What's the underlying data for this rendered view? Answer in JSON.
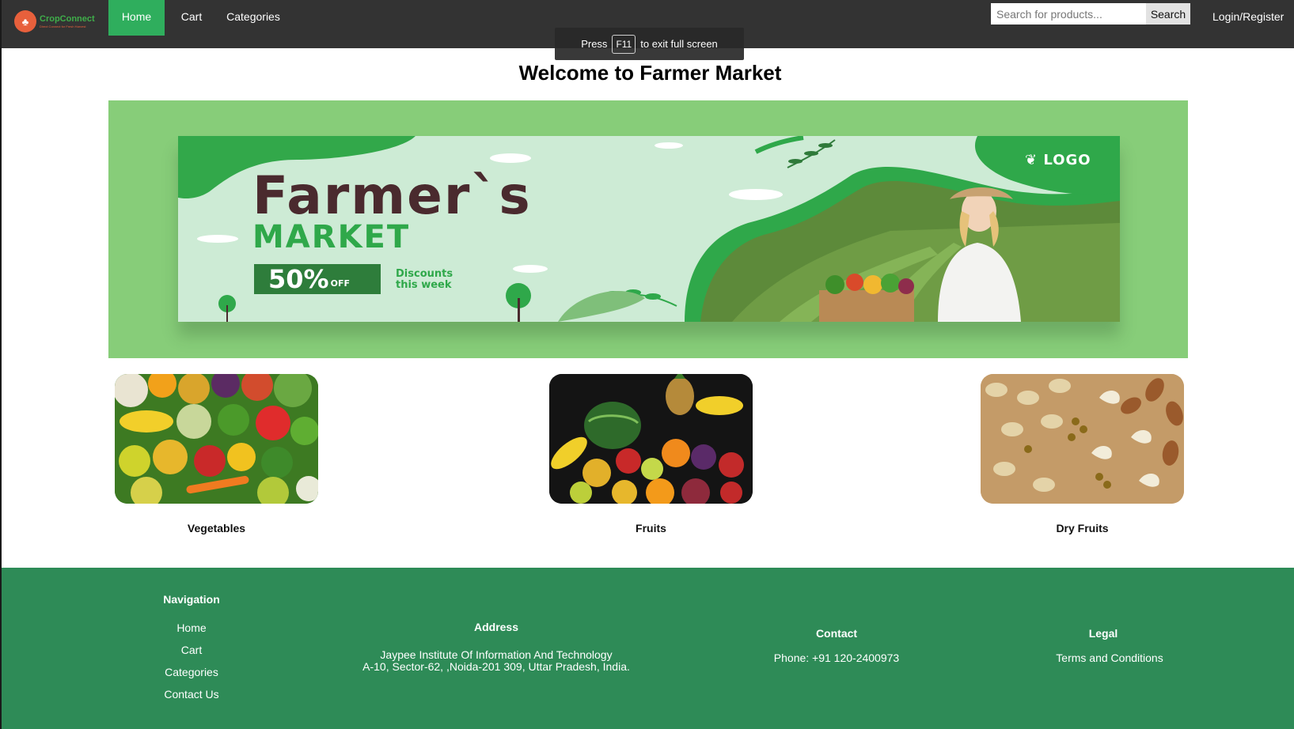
{
  "brand": {
    "name": "CropConnect",
    "tagline": "Direct Connect for Fresh Harvest",
    "icon": "farmer-logo-icon"
  },
  "nav": {
    "links": [
      {
        "label": "Home",
        "active": true
      },
      {
        "label": "Cart",
        "active": false
      },
      {
        "label": "Categories",
        "active": false
      }
    ],
    "search_placeholder": "Search for products...",
    "search_button": "Search",
    "login": "Login/Register"
  },
  "fullscreen_hint": {
    "pre": "Press",
    "key": "F11",
    "post": "to exit full screen"
  },
  "page_title": "Welcome to Farmer Market",
  "banner": {
    "title": "Farmer`s",
    "subtitle": "MARKET",
    "badge_value": "50%",
    "badge_suffix": "OFF",
    "discount_line1": "Discounts",
    "discount_line2": "this week",
    "logo": "LOGO"
  },
  "categories": [
    {
      "label": "Vegetables"
    },
    {
      "label": "Fruits"
    },
    {
      "label": "Dry Fruits"
    }
  ],
  "footer": {
    "navigation_title": "Navigation",
    "navigation_links": [
      "Home",
      "Cart",
      "Categories",
      "Contact Us"
    ],
    "address_title": "Address",
    "address_line1": "Jaypee Institute Of Information And Technology",
    "address_line2": "A-10, Sector-62, ,Noida-201 309, Uttar Pradesh, India.",
    "contact_title": "Contact",
    "phone": "Phone: +91 120-2400973",
    "legal_title": "Legal",
    "terms": "Terms and Conditions"
  },
  "colors": {
    "navbar": "#333333",
    "active_tab": "#2fae5d",
    "banner_frame": "#87cd79",
    "footer": "#2e8b57"
  }
}
